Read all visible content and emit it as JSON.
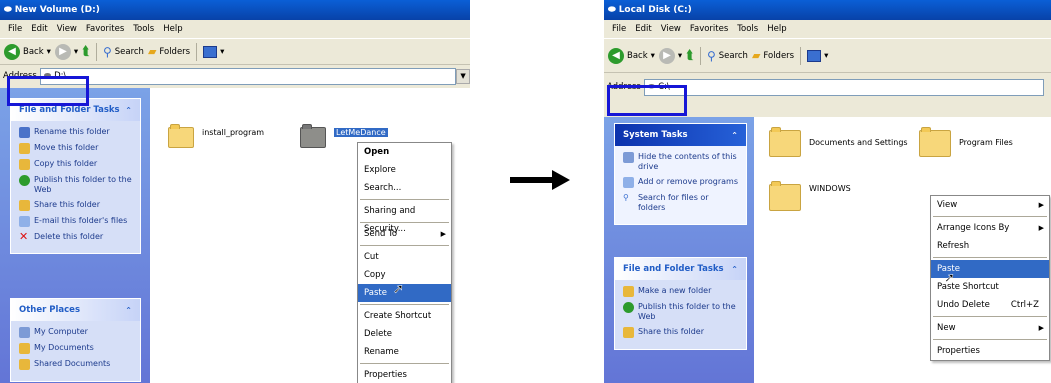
{
  "left": {
    "title": "New Volume (D:)",
    "menu": [
      "File",
      "Edit",
      "View",
      "Favorites",
      "Tools",
      "Help"
    ],
    "toolbar": {
      "back": "Back",
      "search": "Search",
      "folders": "Folders"
    },
    "address_label": "Address",
    "address_value": "D:\\",
    "file_tasks": {
      "title": "File and Folder Tasks",
      "items": [
        "Rename this folder",
        "Move this folder",
        "Copy this folder",
        "Publish this folder to the Web",
        "Share this folder",
        "E-mail this folder's files",
        "Delete this folder"
      ]
    },
    "other_places": {
      "title": "Other Places",
      "items": [
        "My Computer",
        "My Documents",
        "Shared Documents"
      ]
    },
    "folders": [
      "install_program",
      "LetMeDance"
    ],
    "context_menu": [
      "Open",
      "Explore",
      "Search...",
      "Sharing and Security...",
      "Send To",
      "Cut",
      "Copy",
      "Paste",
      "Create Shortcut",
      "Delete",
      "Rename",
      "Properties"
    ]
  },
  "right": {
    "title": "Local Disk (C:)",
    "menu": [
      "File",
      "Edit",
      "View",
      "Favorites",
      "Tools",
      "Help"
    ],
    "toolbar": {
      "back": "Back",
      "search": "Search",
      "folders": "Folders"
    },
    "address_label": "Address",
    "address_value": "C:\\",
    "system_tasks": {
      "title": "System Tasks",
      "items": [
        "Hide the contents of this drive",
        "Add or remove programs",
        "Search for files or folders"
      ]
    },
    "file_tasks": {
      "title": "File and Folder Tasks",
      "items": [
        "Make a new folder",
        "Publish this folder to the Web",
        "Share this folder"
      ]
    },
    "folders": [
      "Documents and Settings",
      "Program Files",
      "WINDOWS"
    ],
    "context_menu": [
      "View",
      "Arrange Icons By",
      "Refresh",
      "Paste",
      "Paste Shortcut",
      "Undo Delete",
      "New",
      "Properties"
    ],
    "undo_shortcut": "Ctrl+Z"
  },
  "colors": {
    "highlight_box": "#1616d6",
    "selection": "#316ac5",
    "arrow": "#000000"
  }
}
